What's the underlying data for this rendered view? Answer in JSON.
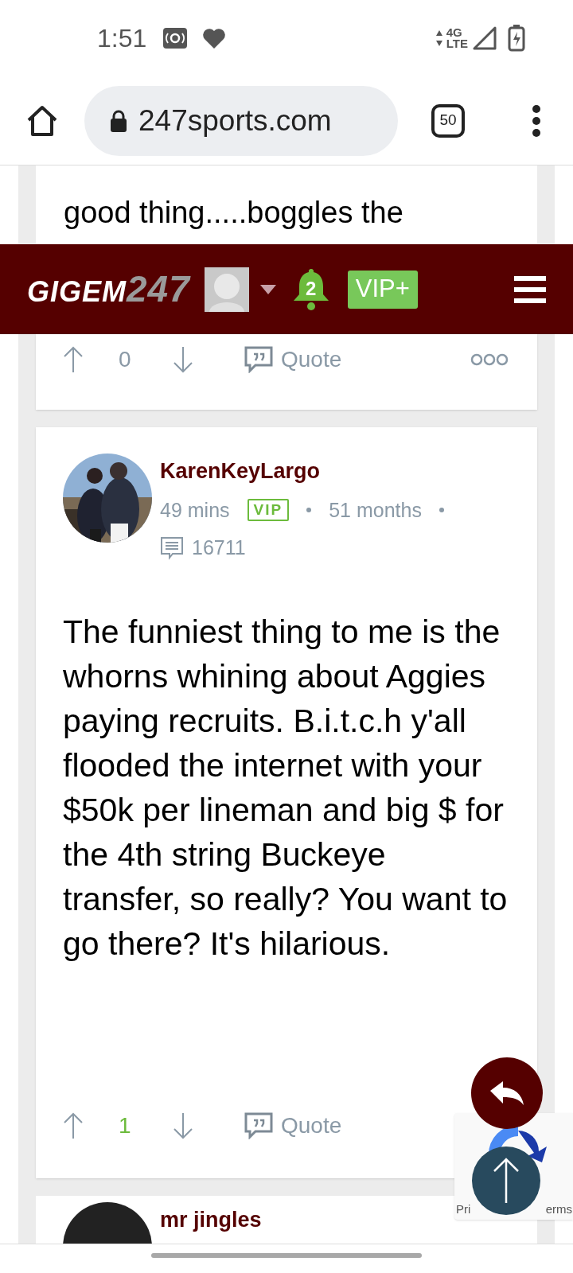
{
  "status_bar": {
    "time": "1:51",
    "network": [
      "4G",
      "LTE"
    ]
  },
  "browser": {
    "url": "247sports.com",
    "tab_count": "50"
  },
  "site_header": {
    "logo_word": "GIGEM",
    "logo_number": "247",
    "notification_count": "2",
    "vip_button": "VIP+"
  },
  "previous_post": {
    "body_visible": "good thing.....boggles the",
    "score": "0",
    "score_positive": false,
    "quote": "Quote"
  },
  "post": {
    "author": "KarenKeyLargo",
    "time": "49 mins",
    "badge": "VIP",
    "tenure": "51 months",
    "post_count": "16711",
    "body": "The funniest thing to me is the whorns whining about Aggies paying recruits. B.i.t.c.h y'all flooded the internet with your $50k per lineman and big $ for the 4th string Buckeye transfer, so really? You want to go there? It's hilarious.",
    "score": "1",
    "score_positive": true,
    "quote": "Quote"
  },
  "next_post": {
    "author": "mr jingles"
  },
  "recaptcha": {
    "text_left": "Pri",
    "text_right": "erms"
  }
}
